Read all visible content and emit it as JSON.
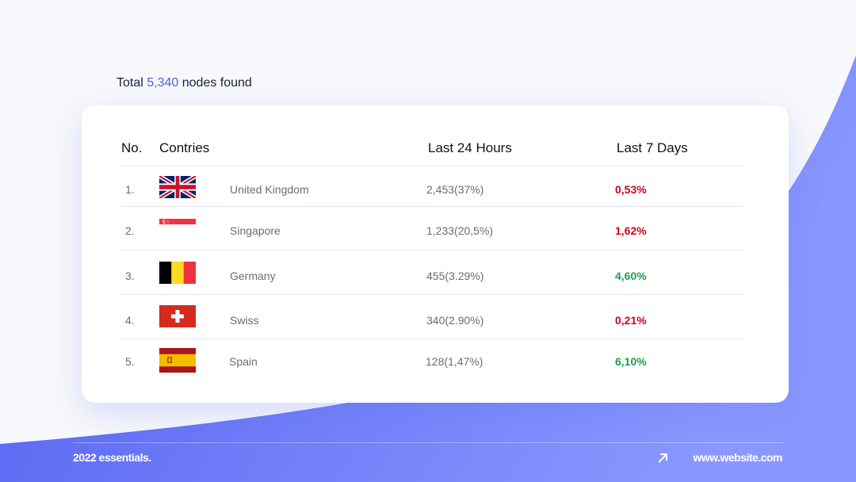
{
  "summary": {
    "prefix": "Total",
    "count": "5,340",
    "suffix": "nodes found"
  },
  "table": {
    "headers": {
      "no": "No.",
      "country": "Contries",
      "last24": "Last 24 Hours",
      "last7": "Last 7 Days"
    },
    "rows": [
      {
        "no": "1.",
        "flag_icon": "uk-flag-icon",
        "country": "United Kingdom",
        "last24": "2,453(37%)",
        "last7": "0,53%",
        "trend_color": "#d0021b"
      },
      {
        "no": "2.",
        "flag_icon": "singapore-flag-icon",
        "country": "Singapore",
        "last24": "1,233(20,5%)",
        "last7": "1,62%",
        "trend_color": "#d0021b"
      },
      {
        "no": "3.",
        "flag_icon": "belgium-flag-icon",
        "country": "Germany",
        "last24": "455(3.29%)",
        "last7": "4,60%",
        "trend_color": "#1e9e4a"
      },
      {
        "no": "4.",
        "flag_icon": "swiss-flag-icon",
        "country": "Swiss",
        "last24": "340(2.90%)",
        "last7": "0,21%",
        "trend_color": "#d0021b"
      },
      {
        "no": "5.",
        "flag_icon": "spain-flag-icon",
        "country": "Spain",
        "last24": "128(1,47%)",
        "last7": "6,10%",
        "trend_color": "#1e9e4a"
      }
    ]
  },
  "footer": {
    "left": "2022 essentials.",
    "right": "www.website.com",
    "arrow_icon": "arrow-up-right-icon"
  },
  "colors": {
    "accent": "#4e5fe0",
    "wave": "#6b7af7",
    "negative": "#d0021b",
    "positive": "#1e9e4a"
  }
}
